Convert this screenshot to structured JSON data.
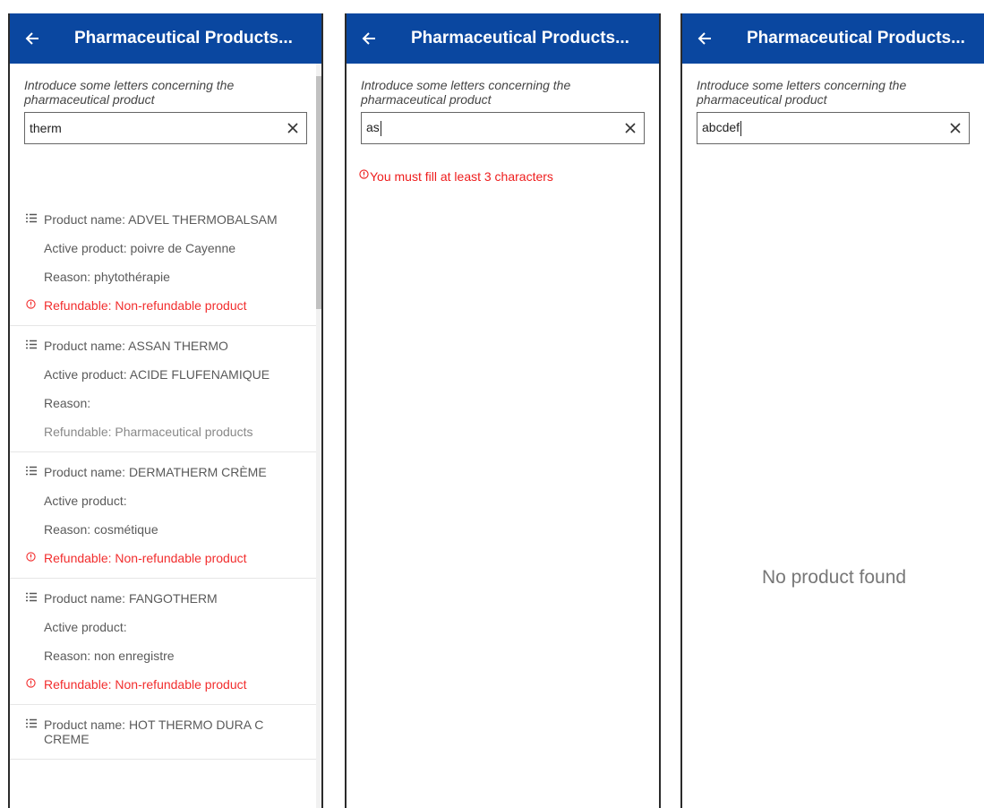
{
  "app_title": "Pharmaceutical Products...",
  "hint": "Introduce some letters concerning the pharmaceutical product",
  "panel1": {
    "query": "therm",
    "items": [
      {
        "name": "Product name: ADVEL THERMOBALSAM",
        "active": "Active product: poivre de Cayenne",
        "reason": "Reason: phytothérapie",
        "refund": "Refundable: Non-refundable product",
        "refund_status": "warn"
      },
      {
        "name": "Product name: ASSAN THERMO",
        "active": "Active product: ACIDE FLUFENAMIQUE",
        "reason": "Reason:",
        "refund": "Refundable: Pharmaceutical products",
        "refund_status": "ok"
      },
      {
        "name": "Product name: DERMATHERM CRÈME",
        "active": "Active product:",
        "reason": "Reason: cosmétique",
        "refund": "Refundable: Non-refundable product",
        "refund_status": "warn"
      },
      {
        "name": "Product name: FANGOTHERM",
        "active": "Active product:",
        "reason": "Reason: non enregistre",
        "refund": "Refundable: Non-refundable product",
        "refund_status": "warn"
      },
      {
        "name": "Product name: HOT THERMO DURA C CREME"
      }
    ]
  },
  "panel2": {
    "query": "as",
    "error": "You must fill at least 3 characters"
  },
  "panel3": {
    "query": "abcdef",
    "empty": "No product found"
  },
  "colors": {
    "appbar": "#0a47a0",
    "error": "#ee1d1d"
  },
  "icons": [
    "arrow-left-icon",
    "close-icon",
    "list-icon",
    "alert-circle-icon"
  ]
}
